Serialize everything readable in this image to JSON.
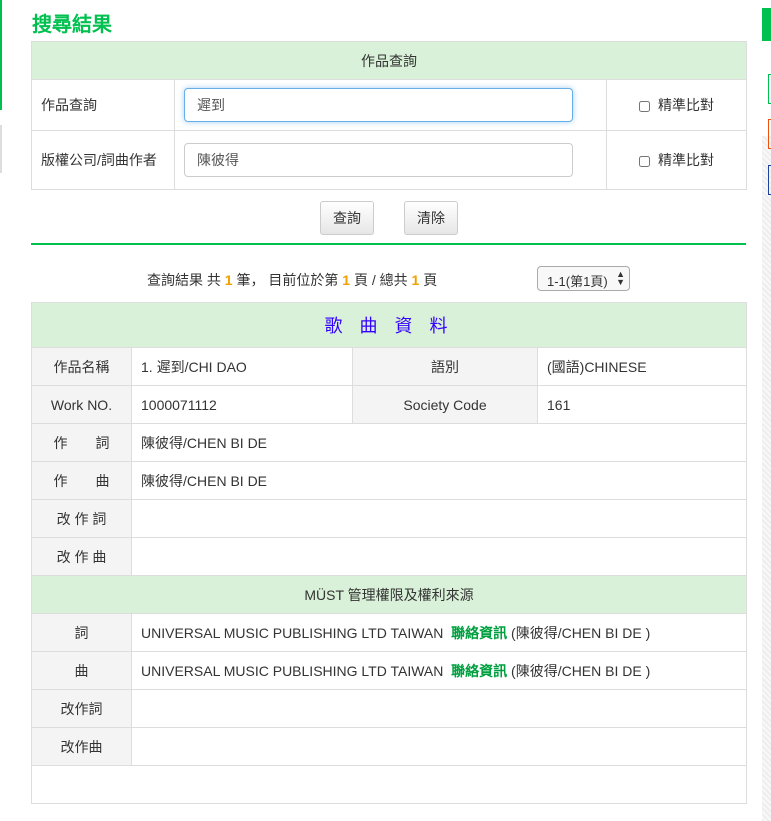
{
  "page_title": "搜尋結果",
  "query": {
    "header": "作品查詢",
    "rows": [
      {
        "label": "作品查詢",
        "value": "遲到",
        "exact_label": "精準比對"
      },
      {
        "label": "版權公司/詞曲作者",
        "value": "陳彼得",
        "exact_label": "精準比對"
      }
    ],
    "search_button": "查詢",
    "clear_button": "清除"
  },
  "status": {
    "prefix": "查詢結果 共",
    "count": "1",
    "mid": "筆， 目前位於第",
    "page": "1",
    "mid2": "頁 / 總共",
    "total": "1",
    "suffix": "頁"
  },
  "pager": {
    "selected": "1-1(第1頁)"
  },
  "song": {
    "header": "歌 曲 資 料",
    "title_label": "作品名稱",
    "title_value": "1. 遲到/CHI DAO",
    "lang_label": "語別",
    "lang_value": "(國語)CHINESE",
    "work_label": "Work NO.",
    "work_value": "1000071112",
    "society_label": "Society Code",
    "society_value": "161",
    "lyricist_label": "作　　詞",
    "lyricist_value": "陳彼得/CHEN BI DE",
    "composer_label": "作　　曲",
    "composer_value": "陳彼得/CHEN BI DE",
    "adapt_lyric_label": "改 作 詞",
    "adapt_music_label": "改 作 曲"
  },
  "rights": {
    "header": "MÜST 管理權限及權利來源",
    "rows": [
      {
        "label": "詞",
        "publisher": "UNIVERSAL MUSIC PUBLISHING LTD TAIWAN",
        "link": "聯絡資訊",
        "note": "(陳彼得/CHEN BI DE )"
      },
      {
        "label": "曲",
        "publisher": "UNIVERSAL MUSIC PUBLISHING LTD TAIWAN",
        "link": "聯絡資訊",
        "note": "(陳彼得/CHEN BI DE )"
      },
      {
        "label": "改作詞"
      },
      {
        "label": "改作曲"
      }
    ]
  },
  "colors": {
    "accent": "#00c050",
    "header_bg": "#d9f1d8",
    "song_header": "#3300ff",
    "link": "#00a040",
    "count": "#f0a000"
  }
}
